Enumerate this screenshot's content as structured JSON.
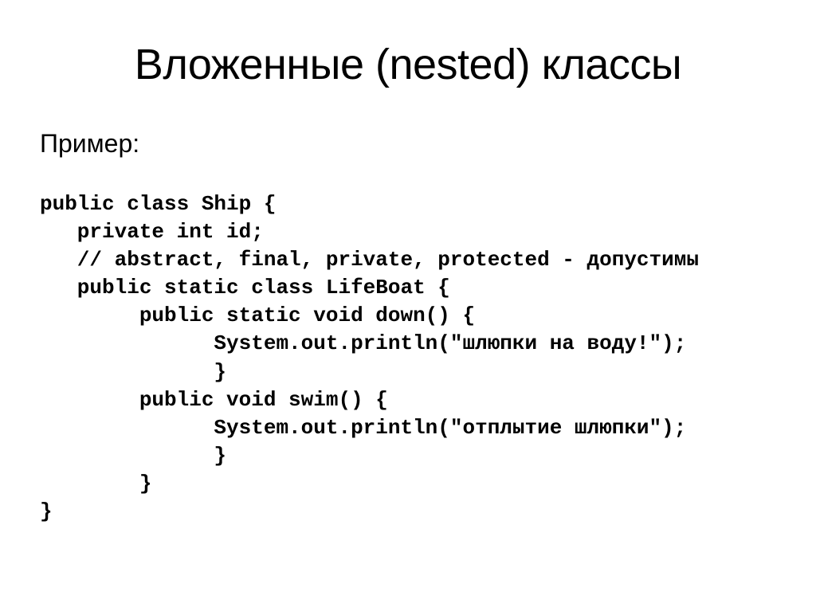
{
  "slide": {
    "title": "Вложенные (nested) классы",
    "subtitle": "Пример:",
    "code": "public class Ship {\n   private int id;\n   // abstract, final, private, protected - допустимы\n   public static class LifeBoat {\n        public static void down() {\n              System.out.println(\"шлюпки на воду!\");\n              }\n        public void swim() {\n              System.out.println(\"отплытие шлюпки\");\n              }\n        }\n}"
  }
}
